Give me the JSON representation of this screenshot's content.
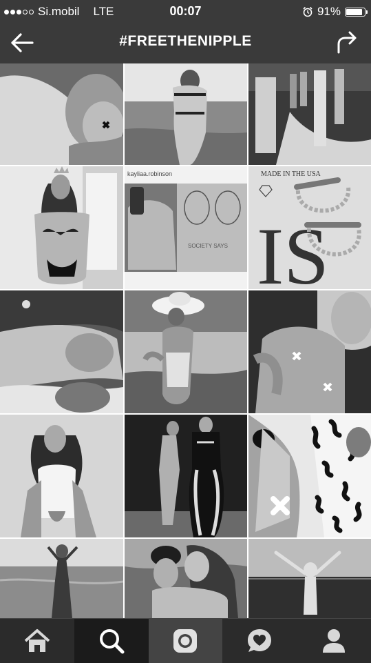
{
  "status_bar": {
    "carrier": "Si.mobil",
    "network": "LTE",
    "time": "00:07",
    "battery_percent": "91%",
    "battery_level": 0.91,
    "signal_bars_filled": 3,
    "signal_bars_total": 5
  },
  "header": {
    "title": "#FREETHENIPPLE",
    "back_icon": "arrow-left-icon",
    "share_icon": "share-arrow-icon"
  },
  "grid": {
    "columns": 3,
    "rows": 5,
    "tile_captions": {
      "r2c2_username": "kayliaa.robinson",
      "r2c2_drawing_text": "SOCIETY SAYS",
      "r2c3_text": "MADE IN THE USA",
      "r2c3_letters": "IS"
    }
  },
  "tab_bar": {
    "tabs": [
      {
        "name": "home",
        "icon": "home-icon"
      },
      {
        "name": "search",
        "icon": "search-icon"
      },
      {
        "name": "camera",
        "icon": "camera-icon"
      },
      {
        "name": "activity",
        "icon": "heart-bubble-icon"
      },
      {
        "name": "profile",
        "icon": "profile-icon"
      }
    ],
    "active_index": 2
  }
}
